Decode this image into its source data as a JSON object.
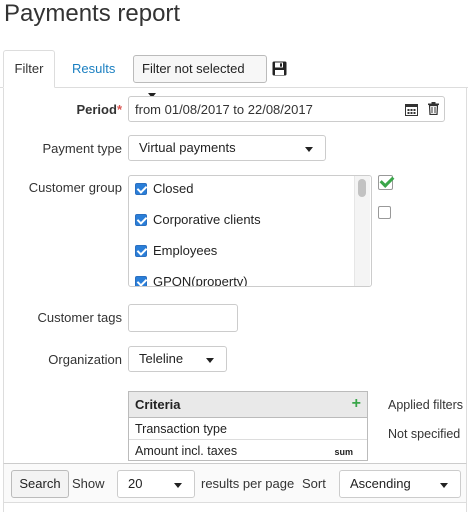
{
  "page": {
    "title": "Payments report"
  },
  "tabs": [
    {
      "label": "Filter",
      "active": true
    },
    {
      "label": "Results",
      "active": false
    }
  ],
  "filter_selector": {
    "value": "Filter not selected"
  },
  "icons": {
    "save": "save-icon",
    "calendar": "calendar-icon",
    "trash": "trash-icon",
    "add": "plus-icon",
    "select_all": "check-icon"
  },
  "colors": {
    "link": "#1a7fc1",
    "required": "#d9534f",
    "checked": "#2a7ed8",
    "success": "#3aa64a"
  },
  "form": {
    "period": {
      "label": "Period",
      "required_mark": "*",
      "value": "from 01/08/2017 to 22/08/2017"
    },
    "payment_type": {
      "label": "Payment type",
      "value": "Virtual payments"
    },
    "customer_group": {
      "label": "Customer group",
      "items": [
        {
          "label": "Closed",
          "checked": true
        },
        {
          "label": "Corporative clients",
          "checked": true
        },
        {
          "label": "Employees",
          "checked": true
        },
        {
          "label": "GPON(property)",
          "checked": true
        }
      ]
    },
    "customer_tags": {
      "label": "Customer tags",
      "value": ""
    },
    "organization": {
      "label": "Organization",
      "value": "Teleline"
    }
  },
  "criteria": {
    "header": "Criteria",
    "add_symbol": "+",
    "rows": [
      {
        "label": "Transaction type",
        "tag": ""
      },
      {
        "label": "Amount incl. taxes",
        "tag": "sum"
      }
    ],
    "applied_filters_label": "Applied filters",
    "applied_filters_value": "Not specified"
  },
  "footer": {
    "search_label": "Search",
    "show_label": "Show",
    "per_page_value": "20",
    "per_page_suffix": "results per page",
    "sort_label": "Sort",
    "sort_value": "Ascending"
  }
}
